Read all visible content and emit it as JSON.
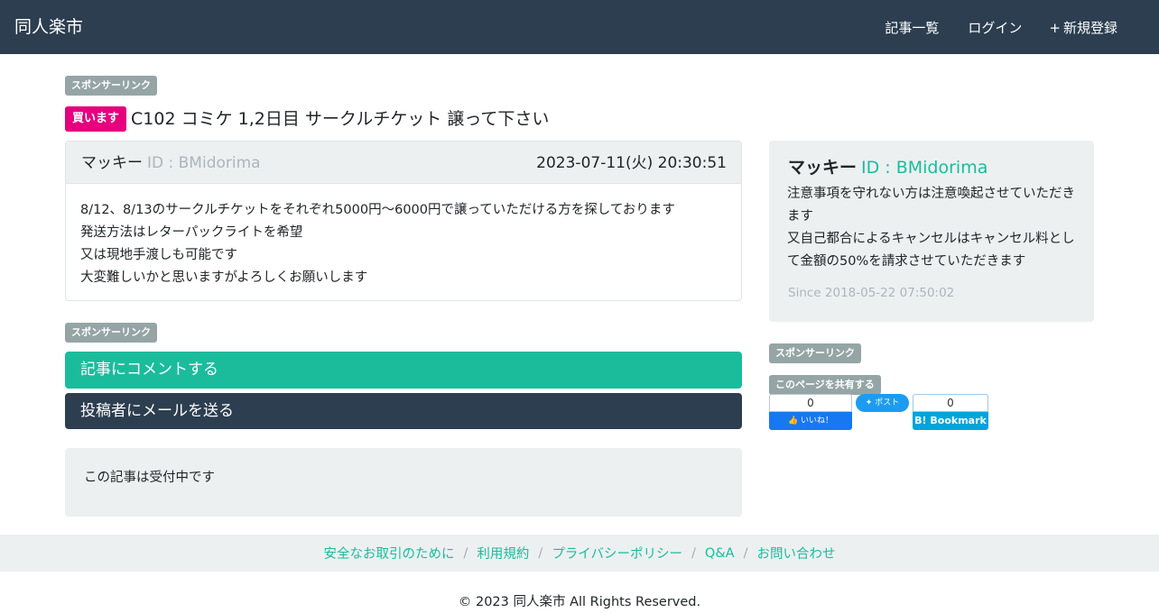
{
  "nav": {
    "brand": "同人楽市",
    "links": [
      {
        "icon": "",
        "label": "記事一覧"
      },
      {
        "icon": "",
        "label": "ログイン"
      },
      {
        "icon": "+",
        "label": "新規登録"
      }
    ]
  },
  "sponsor_label": "スポンサーリンク",
  "post": {
    "badge": "買います",
    "title": "C102 コミケ 1,2日目 サークルチケット 譲って下さい",
    "author_icon": "",
    "author_name": "マッキー",
    "author_id": "ID : BMidorima",
    "date_icon": "",
    "date": "2023-07-11(火) 20:30:51",
    "body_lines": [
      "8/12、8/13のサークルチケットをそれぞれ5000円〜6000円で譲っていただける方を探しております",
      "発送方法はレターパックライトを希望",
      "又は現地手渡しも可能です",
      "大変難しいかと思いますがよろしくお願いします"
    ]
  },
  "actions": {
    "comment": "記事にコメントする",
    "mail": "投稿者にメールを送る"
  },
  "status_text": "この記事は受付中です",
  "profile": {
    "icon": "",
    "name": "マッキー",
    "id": "ID : BMidorima",
    "description": "注意事項を守れない方は注意喚起させていただきます\n又自己都合によるキャンセルはキャンセル料として金額の50%を請求させていただきます",
    "since_icon": "",
    "since": "Since 2018-05-22 07:50:02"
  },
  "share": {
    "label": "このページを共有する",
    "facebook_count": "0",
    "facebook_label": "いいね！",
    "twitter_label": "ポスト",
    "hatena_count": "0",
    "hatena_label": "B! Bookmark"
  },
  "footer": {
    "links": [
      "安全なお取引のために",
      "利用規約",
      "プライバシーポリシー",
      "Q&A",
      "お問い合わせ"
    ],
    "separator": "/",
    "copyright": "© 2023 同人楽市 All Rights Reserved."
  },
  "colors": {
    "navbar": "#2c3e50",
    "accent": "#1abc9c",
    "buy_badge": "#e6007e",
    "sponsor_badge": "#95a5a6",
    "panel": "#ecf0f1"
  }
}
